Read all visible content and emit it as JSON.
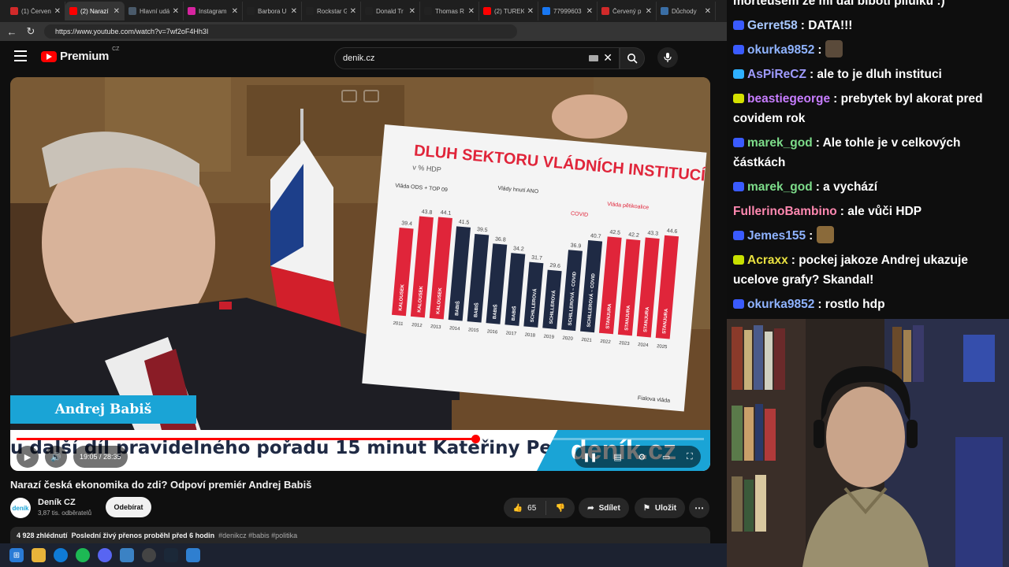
{
  "browser": {
    "tabs": [
      {
        "title": "(1) Červen",
        "color": "#d12a2a",
        "active": false
      },
      {
        "title": "(2) Narazí",
        "color": "#ff0000",
        "active": true
      },
      {
        "title": "Hlavní udá",
        "color": "#4a5a6a",
        "active": false
      },
      {
        "title": "Instagram",
        "color": "#d6249f",
        "active": false
      },
      {
        "title": "Barbora U",
        "color": "#222222",
        "active": false
      },
      {
        "title": "Rockstar G",
        "color": "#222222",
        "active": false
      },
      {
        "title": "Donald Tr",
        "color": "#222222",
        "active": false
      },
      {
        "title": "Thomas R",
        "color": "#222222",
        "active": false
      },
      {
        "title": "(2) TUREK",
        "color": "#ff0000",
        "active": false
      },
      {
        "title": "77999603",
        "color": "#1877f2",
        "active": false
      },
      {
        "title": "Červený p",
        "color": "#d12a2a",
        "active": false
      },
      {
        "title": "Důchody",
        "color": "#3a6ea5",
        "active": false
      }
    ],
    "url": "https://www.youtube.com/watch?v=7wf2oF4Hh3I"
  },
  "youtube": {
    "logo_word": "Premium",
    "logo_region": "CZ",
    "search_value": "denik.cz",
    "video": {
      "name_banner": "Andrej Babiš",
      "ticker_text": "u další díl pravidelného pořadu 15 minut Kateřiny Pe",
      "ticker_brand": "deník.cz",
      "time_display": "19:05 / 28:35",
      "progress_fraction": 0.667,
      "board_title": "DLUH SEKTORU VLÁDNÍCH INSTITUCÍ",
      "board_unit": "v % HDP",
      "board_values": [
        "39.4",
        "43.8",
        "44.1",
        "41.5",
        "39.5",
        "36.8",
        "34.2",
        "31.7",
        "29.6",
        "36.9",
        "40.7",
        "42.5",
        "42.2",
        "43.3",
        "44.6"
      ],
      "board_labels": [
        "KALOUSEK",
        "KALOUSEK",
        "KALOUSEK",
        "BABIŠ",
        "BABIŠ",
        "BABIŠ",
        "BABIŠ",
        "SCHILLEROVÁ",
        "SCHILLEROVÁ",
        "SCHILLEROVÁ – COVID",
        "SCHILLEROVÁ – COVID",
        "STANJURA",
        "STANJURA",
        "STANJURA",
        "STANJURA"
      ],
      "board_years": [
        "2011",
        "2012",
        "2013",
        "2014",
        "2015",
        "2016",
        "2017",
        "2018",
        "2019",
        "2020",
        "2021",
        "2022",
        "2023",
        "2024",
        "2025"
      ],
      "board_notes": [
        "Vláda ODS + TOP 09",
        "Vlády hnutí ANO",
        "COVID",
        "Vláda pětikoalice",
        "Fialova vláda"
      ]
    },
    "title": "Narazí česká ekonomika do zdi? Odpoví premiér Andrej Babiš",
    "channel": {
      "name": "Deník CZ",
      "subs": "3,87 tis. odběratelů",
      "avatar_text": "deník"
    },
    "subscribe_label": "Odebírat",
    "likes": "65",
    "share_label": "Sdílet",
    "save_label": "Uložit",
    "description": {
      "views": "4 928 zhlédnutí",
      "live": "Poslední živý přenos proběhl před 6 hodin",
      "tags": "#denikcz #babis #politika"
    }
  },
  "chat": {
    "top_fragment": "morteusem ze mi dal biboti pilulku :)",
    "messages": [
      {
        "user": "Gerret58",
        "color": "#a8c8ff",
        "text": "DATA!!!",
        "badge": "#3a5bff"
      },
      {
        "user": "okurka9852",
        "color": "#8fb3ff",
        "text": "",
        "badge": "#3a5bff",
        "emote": "#5a4a3a"
      },
      {
        "user": "AsPiReCZ",
        "color": "#9f9bff",
        "text": "ale to je dluh instituci",
        "badge": "#2fb0ff"
      },
      {
        "user": "beastiegeorge",
        "color": "#c77dff",
        "text": "prebytek byl akorat pred covidem rok",
        "badge": "#d4e000"
      },
      {
        "user": "marek_god",
        "color": "#7ddc8a",
        "text": "Ale tohle je v celkových částkách",
        "badge": "#3a5bff"
      },
      {
        "user": "marek_god",
        "color": "#7ddc8a",
        "text": "a vychází",
        "badge": "#3a5bff"
      },
      {
        "user": "FullerinoBambino",
        "color": "#ff88b0",
        "text": "ale vůči HDP",
        "badge": ""
      },
      {
        "user": "Jemes155",
        "color": "#8fb3ff",
        "text": "",
        "badge": "#3a5bff",
        "emote": "#8a6a3a"
      },
      {
        "user": "Acraxx",
        "color": "#e8e040",
        "text": "pockej jakoze Andrej ukazuje ucelove grafy? Skandal!",
        "badge": "#c8e000"
      },
      {
        "user": "okurka9852",
        "color": "#8fb3ff",
        "text": "rostlo hdp",
        "badge": "#3a5bff"
      }
    ]
  }
}
